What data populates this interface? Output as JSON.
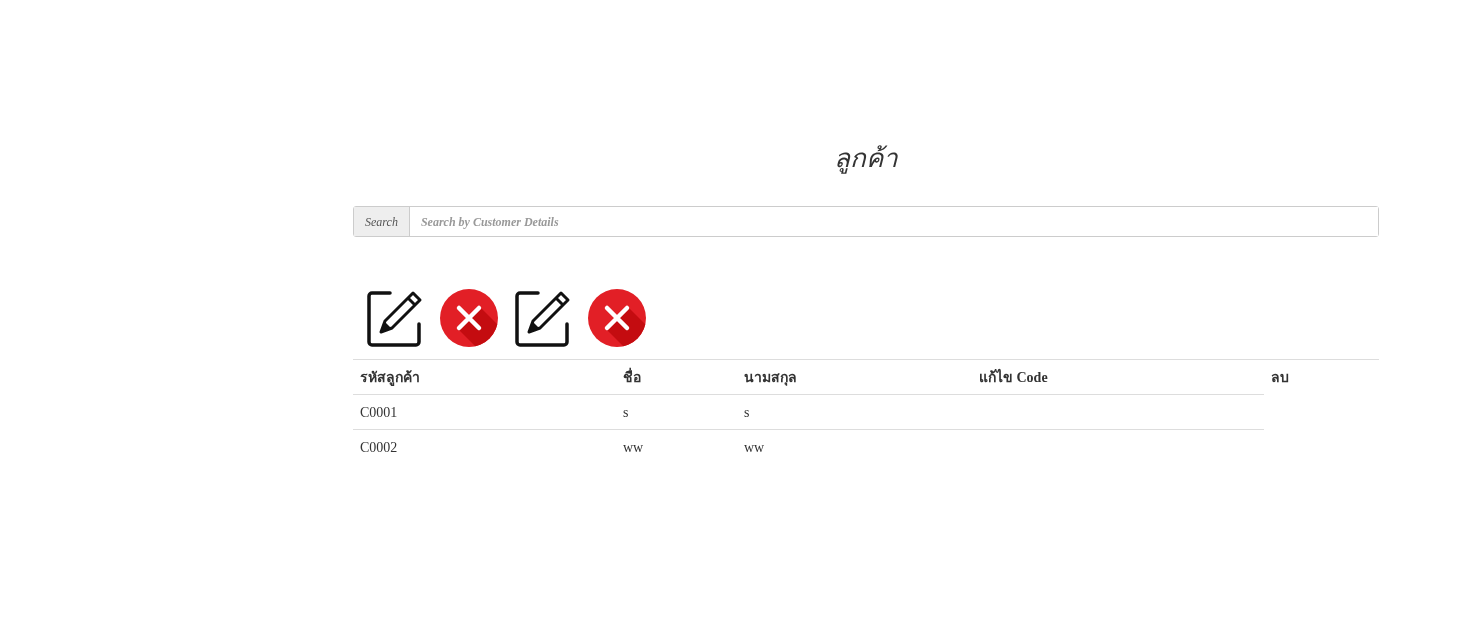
{
  "title": "ลูกค้า",
  "search": {
    "label": "Search",
    "placeholder": "Search by Customer Details"
  },
  "actions": [
    {
      "kind": "edit"
    },
    {
      "kind": "delete"
    },
    {
      "kind": "edit"
    },
    {
      "kind": "delete"
    }
  ],
  "table": {
    "columns": [
      "รหัสลูกค้า",
      "ชื่อ",
      "นามสกุล",
      "แก้ไข Code",
      "ลบ"
    ],
    "rows": [
      [
        "C0001",
        "s",
        "s"
      ],
      [
        "C0002",
        "ww",
        "ww"
      ]
    ]
  }
}
